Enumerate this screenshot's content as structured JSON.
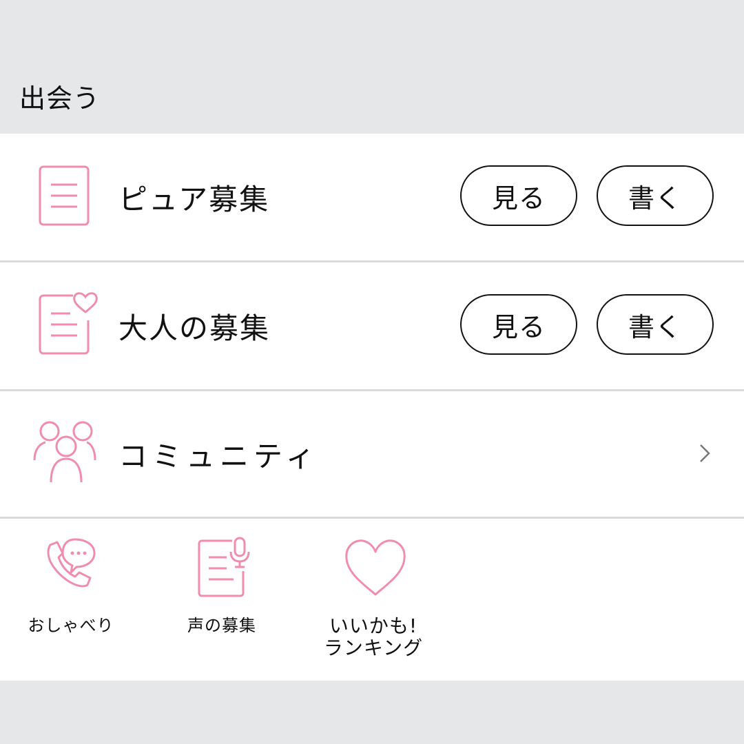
{
  "section": {
    "title": "出会う"
  },
  "colors": {
    "accent": "#f08cae",
    "border": "#111111",
    "background": "#e6e7e8"
  },
  "rows": [
    {
      "label": "ピュア募集",
      "icon": "document-icon",
      "view_label": "見る",
      "write_label": "書く"
    },
    {
      "label": "大人の募集",
      "icon": "document-heart-icon",
      "view_label": "見る",
      "write_label": "書く"
    },
    {
      "label": "コミュニティ",
      "icon": "people-group-icon"
    }
  ],
  "tiles": [
    {
      "label": "おしゃべり",
      "icon": "phone-chat-icon"
    },
    {
      "label": "声の募集",
      "icon": "document-mic-icon"
    },
    {
      "label_line1": "いいかも!",
      "label_line2": "ランキング",
      "icon": "heart-icon"
    }
  ]
}
